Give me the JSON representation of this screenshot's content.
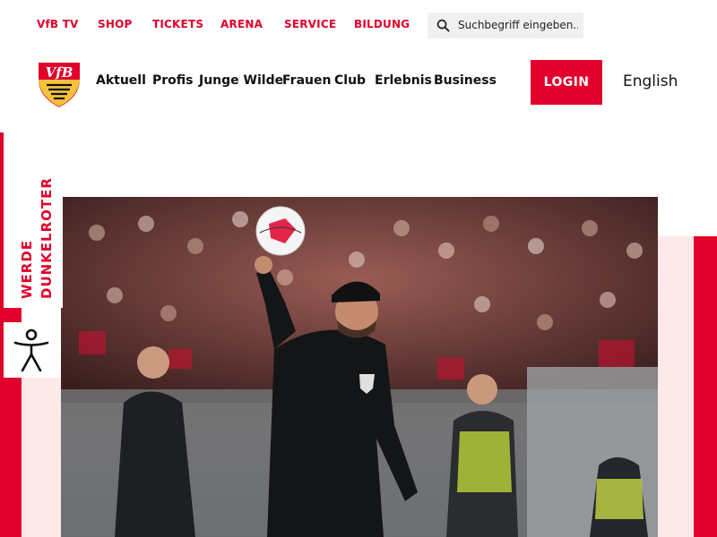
{
  "top_nav": {
    "items": [
      "VfB TV",
      "SHOP",
      "TICKETS",
      "ARENA",
      "SERVICE",
      "BILDUNG"
    ],
    "search_placeholder": "Suchbegriff eingeben..."
  },
  "main_nav": {
    "items": [
      "Aktuell",
      "Profis",
      "Junge Wilde",
      "Frauen",
      "Club",
      "Erlebnis",
      "Business"
    ],
    "login_label": "LOGIN",
    "language_label": "English"
  },
  "side_banner": {
    "text": "WERDE DUNKELROTER"
  },
  "colors": {
    "brand_red": "#e0002b",
    "light_pink": "#fde8ea",
    "gold": "#f3c23a"
  },
  "icons": {
    "search": "search-icon",
    "logo": "vfb-crest-logo",
    "accessibility": "accessibility-icon"
  }
}
